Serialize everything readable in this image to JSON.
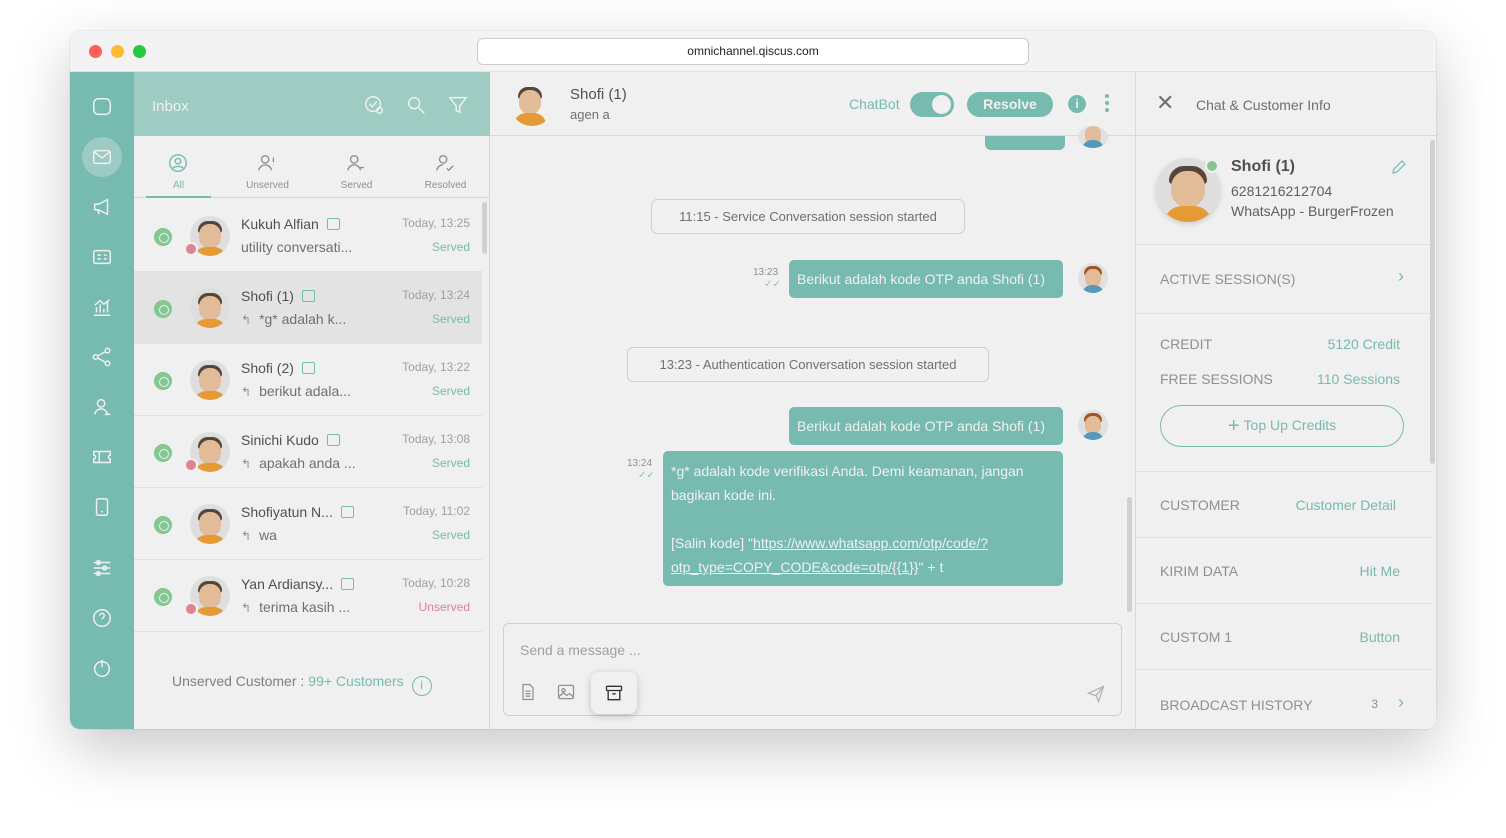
{
  "browser": {
    "url": "omnichannel.qiscus.com",
    "dots": [
      "#fe5f57",
      "#febc2e",
      "#28c840"
    ]
  },
  "nav": {
    "items": [
      {
        "name": "chat-bubble-icon"
      },
      {
        "name": "mail-icon",
        "active": true
      },
      {
        "name": "megaphone-icon"
      },
      {
        "name": "contact-card-icon"
      },
      {
        "name": "analytics-icon"
      },
      {
        "name": "integration-icon"
      },
      {
        "name": "agent-icon"
      },
      {
        "name": "ticket-icon"
      },
      {
        "name": "mobile-icon"
      },
      {
        "name": "settings-sliders-icon"
      },
      {
        "name": "help-icon"
      },
      {
        "name": "power-icon"
      }
    ]
  },
  "inbox": {
    "title": "Inbox",
    "tabs": [
      {
        "label": "All",
        "active": true
      },
      {
        "label": "Unserved"
      },
      {
        "label": "Served"
      },
      {
        "label": "Resolved"
      }
    ],
    "conversations": [
      {
        "name": "Kukuh Alfian",
        "preview": "utility conversati...",
        "time": "Today, 13:25",
        "status": "Served",
        "reply": false,
        "badge": true
      },
      {
        "name": "Shofi (1)",
        "preview": "*g* adalah k...",
        "time": "Today, 13:24",
        "status": "Served",
        "reply": true,
        "badge": false,
        "selected": true
      },
      {
        "name": "Shofi (2)",
        "preview": "berikut adala...",
        "time": "Today, 13:22",
        "status": "Served",
        "reply": true,
        "badge": false
      },
      {
        "name": "Sinichi Kudo",
        "preview": "apakah anda ...",
        "time": "Today, 13:08",
        "status": "Served",
        "reply": true,
        "badge": true
      },
      {
        "name": "Shofiyatun N...",
        "preview": "wa",
        "time": "Today, 11:02",
        "status": "Served",
        "reply": true,
        "badge": false
      },
      {
        "name": "Yan Ardiansy...",
        "preview": "terima kasih ...",
        "time": "Today, 10:28",
        "status": "Unserved",
        "reply": true,
        "badge": true
      }
    ],
    "footer_label": "Unserved Customer :",
    "footer_value": "99+ Customers",
    "footer_info": "i"
  },
  "chat": {
    "name": "Shofi (1)",
    "sub": "agen a",
    "chatbot_label": "ChatBot",
    "chatbot_on": true,
    "resolve_label": "Resolve",
    "info_label": "i",
    "system1": "11:15 - Service Conversation session started",
    "msg1_time": "13:23",
    "msg1": "Berikut adalah kode OTP anda Shofi (1)",
    "system2": "13:23 - Authentication Conversation session started",
    "msg2": "Berikut adalah kode OTP anda Shofi (1)",
    "msg3_time": "13:24",
    "msg3_line1": "*g* adalah kode verifikasi Anda. Demi keamanan, jangan",
    "msg3_line2": "bagikan kode ini.",
    "msg3_line3_prefix": "[Salin kode] \"",
    "msg3_link1": "https://www.whatsapp.com/otp/code/?",
    "msg3_link2": "otp_type=COPY_CODE&code=otp/{{1}}",
    "msg3_line4_suffix": "\" + t",
    "ticks": "✓✓",
    "placeholder": "Send a message ..."
  },
  "panel": {
    "title": "Chat & Customer Info",
    "close": "✕",
    "name": "Shofi (1)",
    "phone": "6281216212704",
    "channel": "WhatsApp - BurgerFrozen",
    "active_sessions": "ACTIVE SESSION(S)",
    "credit_label": "CREDIT",
    "credit_value": "5120 Credit",
    "free_label": "FREE SESSIONS",
    "free_value": "110 Sessions",
    "topup_plus": "+",
    "topup_label": "Top Up Credits",
    "customer_label": "CUSTOMER",
    "customer_value": "Customer Detail",
    "kirim_label": "KIRIM DATA",
    "kirim_value": "Hit Me",
    "custom1_label": "CUSTOM 1",
    "custom1_value": "Button",
    "broadcast_label": "BROADCAST HISTORY",
    "broadcast_count": "3",
    "chevron": "›"
  },
  "colors": {
    "accent": "#7fc6bb",
    "unserved": "#e98c9b"
  }
}
